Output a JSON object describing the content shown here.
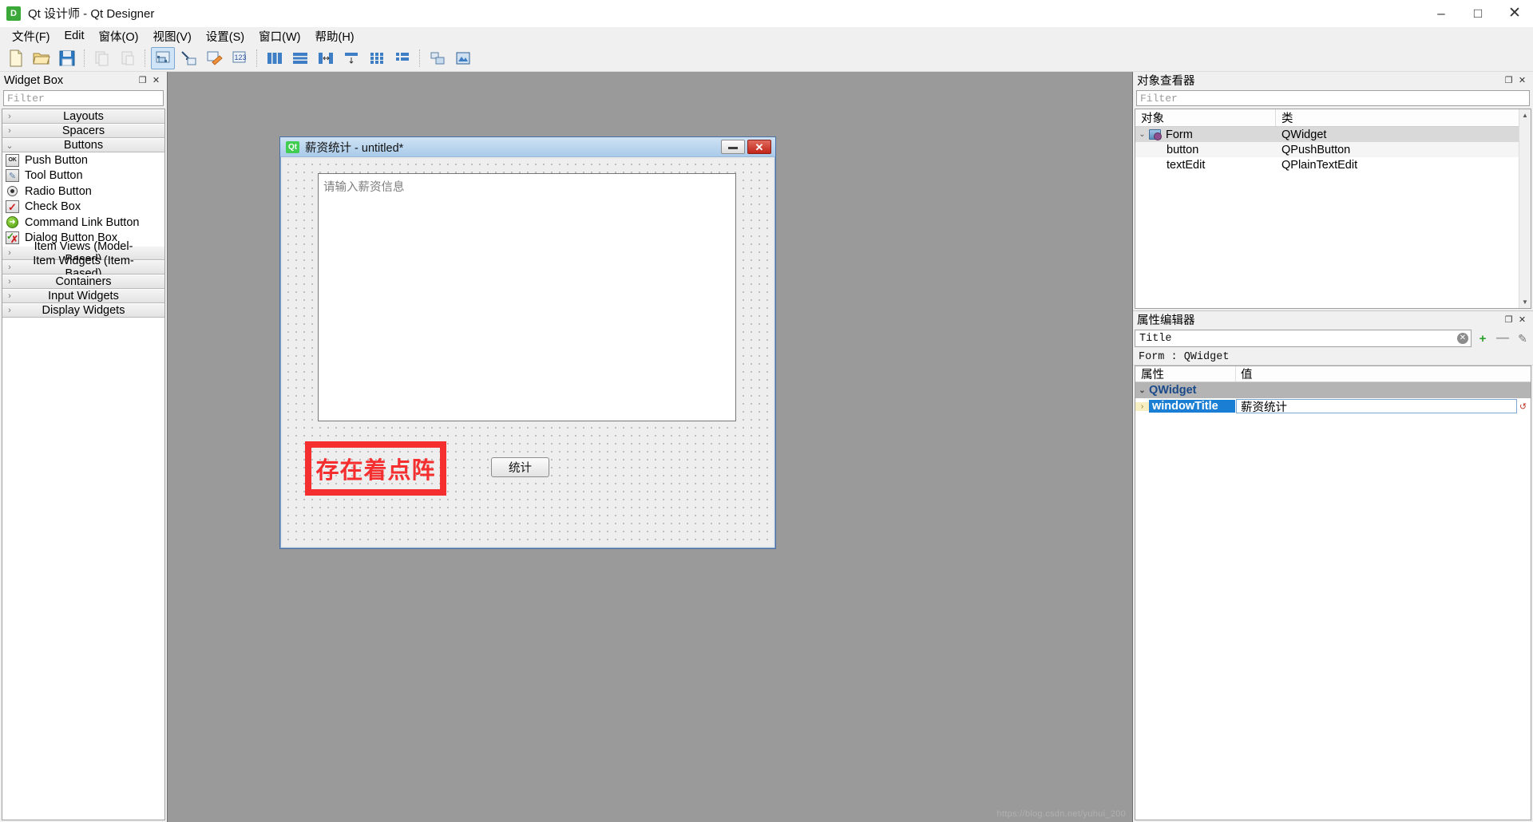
{
  "window": {
    "app_icon": "D",
    "title": "Qt 设计师 - Qt Designer",
    "minimize": "–",
    "maximize": "□",
    "close": "✕"
  },
  "menubar": {
    "items": [
      {
        "label": "文件(F)",
        "accel": "F"
      },
      {
        "label": "Edit",
        "accel": "E"
      },
      {
        "label": "窗体(O)",
        "accel": "O"
      },
      {
        "label": "视图(V)",
        "accel": "V"
      },
      {
        "label": "设置(S)",
        "accel": "S"
      },
      {
        "label": "窗口(W)",
        "accel": "W"
      },
      {
        "label": "帮助(H)",
        "accel": "H"
      }
    ]
  },
  "toolbar": {
    "groups": [
      [
        "new-file-icon",
        "open-folder-icon",
        "save-icon"
      ],
      [
        "copy-icon",
        "paste-icon"
      ],
      [
        "edit-widgets-icon",
        "edit-signals-icon",
        "edit-buddies-icon",
        "edit-tab-order-icon"
      ],
      [
        "layout-horizontal-icon",
        "layout-vertical-icon",
        "layout-splitter-h-icon",
        "layout-splitter-v-icon",
        "layout-grid-icon",
        "layout-form-icon"
      ],
      [
        "break-layout-icon",
        "adjust-size-icon"
      ]
    ]
  },
  "widget_box": {
    "title": "Widget Box",
    "float_btn": "❐",
    "close_btn": "✕",
    "filter_placeholder": "Filter",
    "categories": [
      {
        "label": "Layouts",
        "expanded": false,
        "arrow": "›",
        "items": []
      },
      {
        "label": "Spacers",
        "expanded": false,
        "arrow": "›",
        "items": []
      },
      {
        "label": "Buttons",
        "expanded": true,
        "arrow": "⌄",
        "items": [
          {
            "label": "Push Button",
            "icon": "push-button-icon"
          },
          {
            "label": "Tool Button",
            "icon": "tool-button-icon"
          },
          {
            "label": "Radio Button",
            "icon": "radio-button-icon"
          },
          {
            "label": "Check Box",
            "icon": "check-box-icon"
          },
          {
            "label": "Command Link Button",
            "icon": "command-link-button-icon"
          },
          {
            "label": "Dialog Button Box",
            "icon": "dialog-button-box-icon"
          }
        ]
      },
      {
        "label": "Item Views (Model-Based)",
        "expanded": false,
        "arrow": "›",
        "items": []
      },
      {
        "label": "Item Widgets (Item-Based)",
        "expanded": false,
        "arrow": "›",
        "items": []
      },
      {
        "label": "Containers",
        "expanded": false,
        "arrow": "›",
        "items": []
      },
      {
        "label": "Input Widgets",
        "expanded": false,
        "arrow": "›",
        "items": []
      },
      {
        "label": "Display Widgets",
        "expanded": false,
        "arrow": "›",
        "items": []
      }
    ]
  },
  "form": {
    "qt_logo": "Qt",
    "title": "薪资统计 - untitled*",
    "minimize": "—",
    "close": "✕",
    "plain_text_edit": {
      "placeholder": "请输入薪资信息",
      "value": ""
    },
    "annotation": {
      "text": "存在着点阵",
      "color": "#f52f2f"
    },
    "button": {
      "label": "统计"
    }
  },
  "object_inspector": {
    "title": "对象查看器",
    "float_btn": "❐",
    "close_btn": "✕",
    "filter_placeholder": "Filter",
    "columns": [
      "对象",
      "类"
    ],
    "rows": [
      {
        "arrow": "⌄",
        "icon": "form-widget-icon",
        "object": "Form",
        "class": "QWidget",
        "selected": true,
        "indent": 0
      },
      {
        "arrow": "",
        "icon": "",
        "object": "button",
        "class": "QPushButton",
        "selected": false,
        "indent": 1
      },
      {
        "arrow": "",
        "icon": "",
        "object": "textEdit",
        "class": "QPlainTextEdit",
        "selected": false,
        "indent": 1
      }
    ]
  },
  "property_editor": {
    "title": "属性编辑器",
    "float_btn": "❐",
    "close_btn": "✕",
    "filter_value": "Title",
    "clear_icon": "✕",
    "add_btn": "+",
    "remove_btn": "—",
    "config_btn": "✎",
    "context": "Form : QWidget",
    "columns": [
      "属性",
      "值"
    ],
    "groups": [
      {
        "name": "QWidget",
        "arrow": "⌄",
        "rows": [
          {
            "arrow": "›",
            "name": "windowTitle",
            "value": "薪资统计",
            "selected": true,
            "reset_icon": "↺"
          }
        ]
      }
    ]
  },
  "watermark": "https://blog.csdn.net/yuhui_200"
}
